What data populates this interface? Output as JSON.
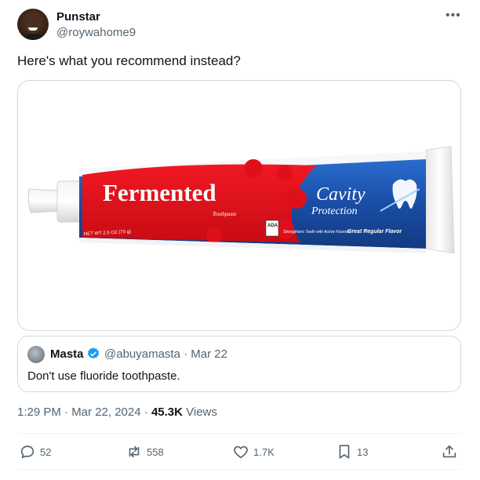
{
  "author": {
    "display_name": "Punstar",
    "handle": "@roywahome9"
  },
  "tweet": {
    "text": "Here's what you recommend instead?",
    "timestamp": "1:29 PM · Mar 22, 2024",
    "views_count": "45.3K",
    "views_label": "Views"
  },
  "media": {
    "tube_brand": "Fermented",
    "tube_sub": "Toothpaste",
    "net_wt": "NET WT 2.5 OZ (70 g)",
    "ada_label": "ADA",
    "cavity_line1": "Cavity",
    "cavity_line2": "Protection",
    "strengthens": "Strengthens Teeth with Active Fluoride",
    "flavor": "Great Regular Flavor"
  },
  "quote": {
    "display_name": "Masta",
    "handle": "@abuyamasta",
    "date": "Mar 22",
    "separator": "·",
    "text": "Don't use fluoride toothpaste."
  },
  "actions": {
    "replies": "52",
    "retweets": "558",
    "likes": "1.7K",
    "bookmarks": "13"
  },
  "colors": {
    "accent": "#1d9bf0",
    "text_secondary": "#536471",
    "tube_red": "#e0101a",
    "tube_blue": "#1a4ea8"
  }
}
